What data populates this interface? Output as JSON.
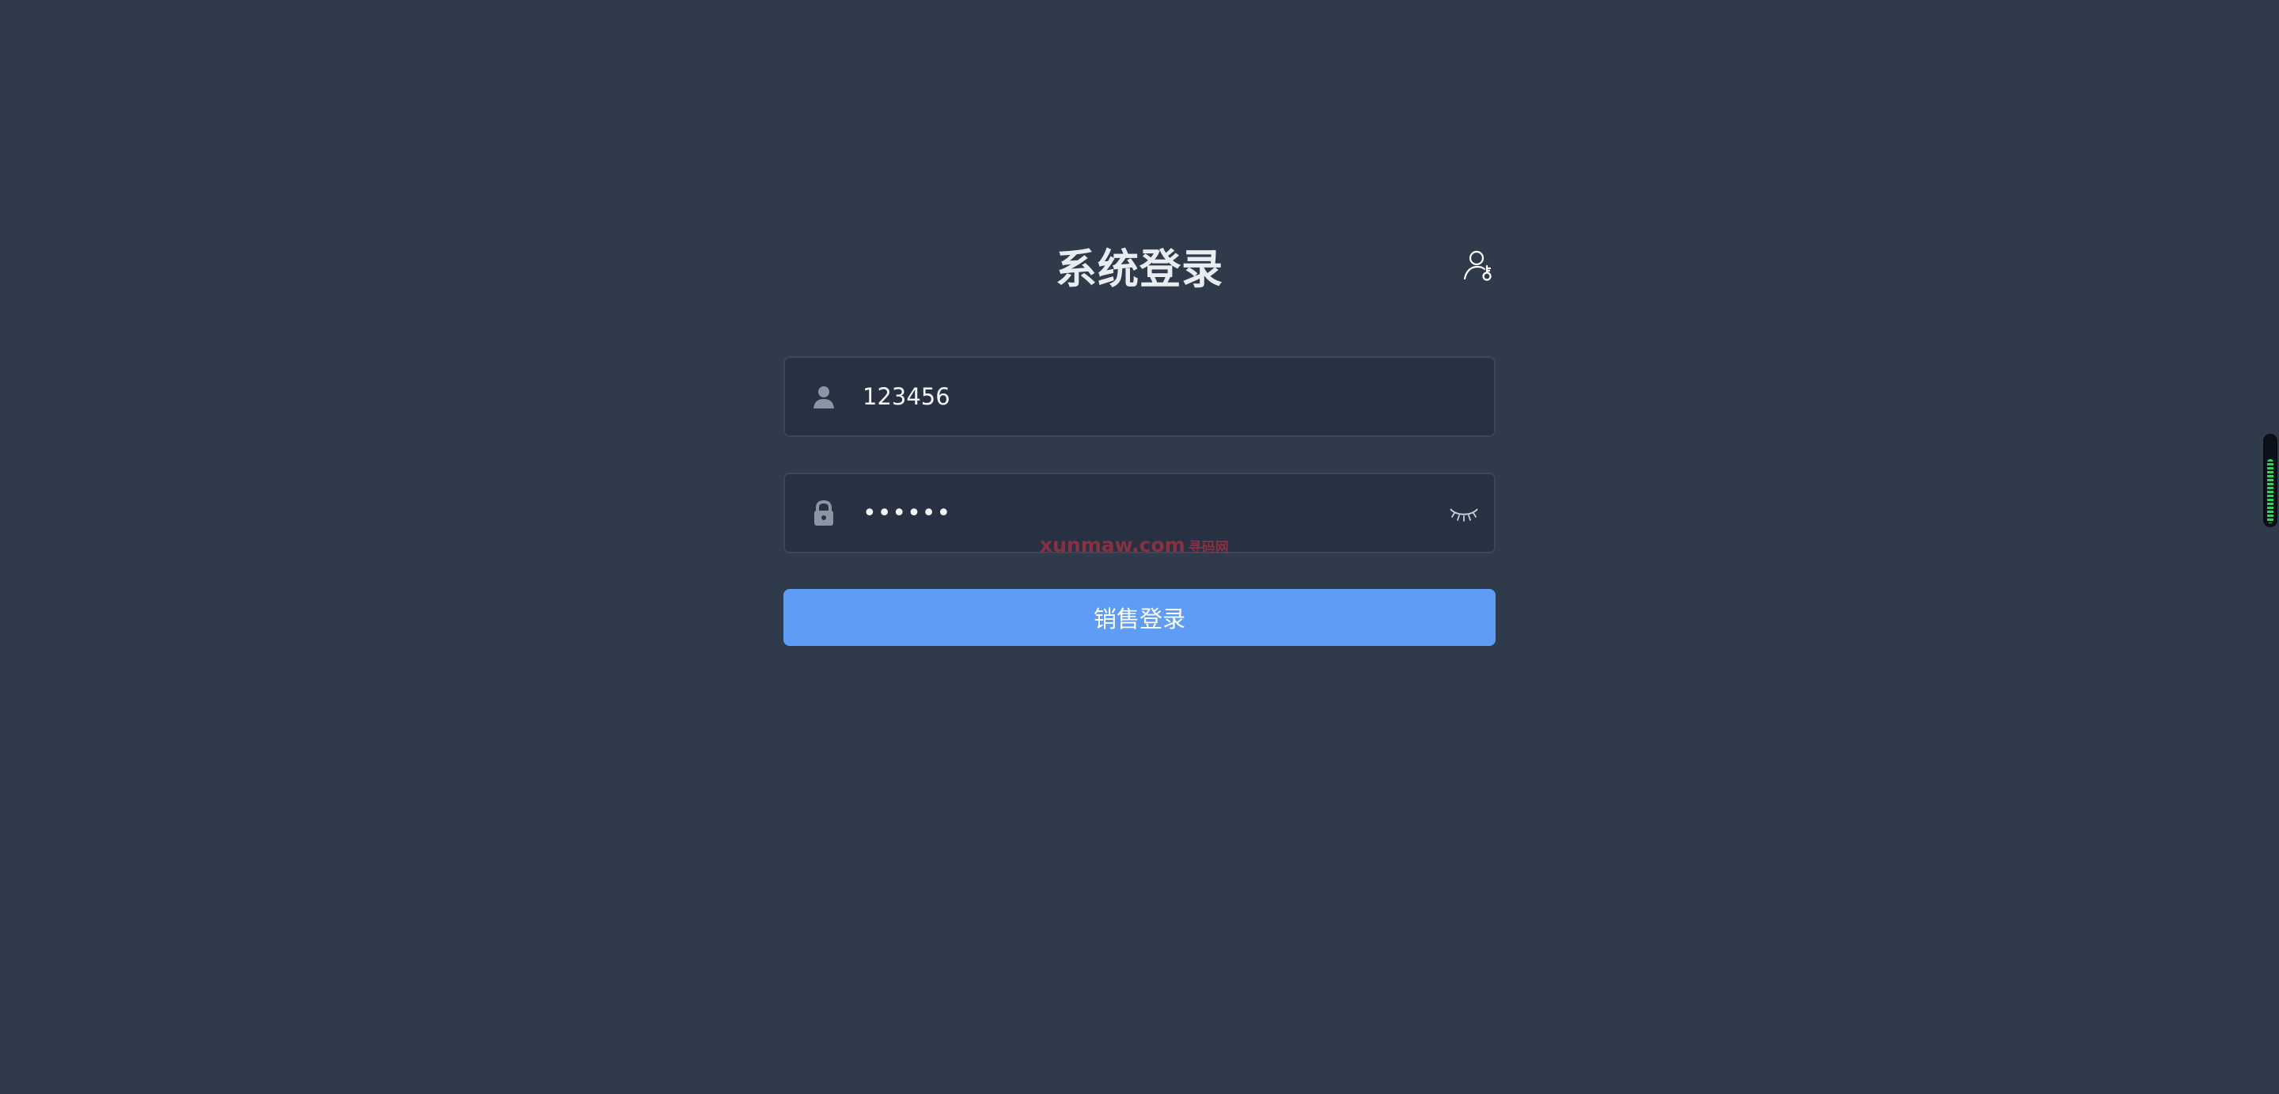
{
  "page": {
    "title": "系统登录",
    "background_color": "#2f3a4b",
    "accent_color": "#5f9cf6"
  },
  "header": {
    "role_switch_icon": "user-key-icon"
  },
  "login_form": {
    "username": {
      "value": "123456",
      "icon": "user-icon"
    },
    "password": {
      "value": "123456",
      "icon": "lock-icon",
      "visibility_icon": "eye-closed-icon"
    },
    "submit_label": "销售登录"
  },
  "watermark": {
    "text": "xunmaw.com",
    "small_text": "寻码网"
  },
  "side_gauge": {
    "level": 0.71,
    "color": "#31d35a"
  }
}
